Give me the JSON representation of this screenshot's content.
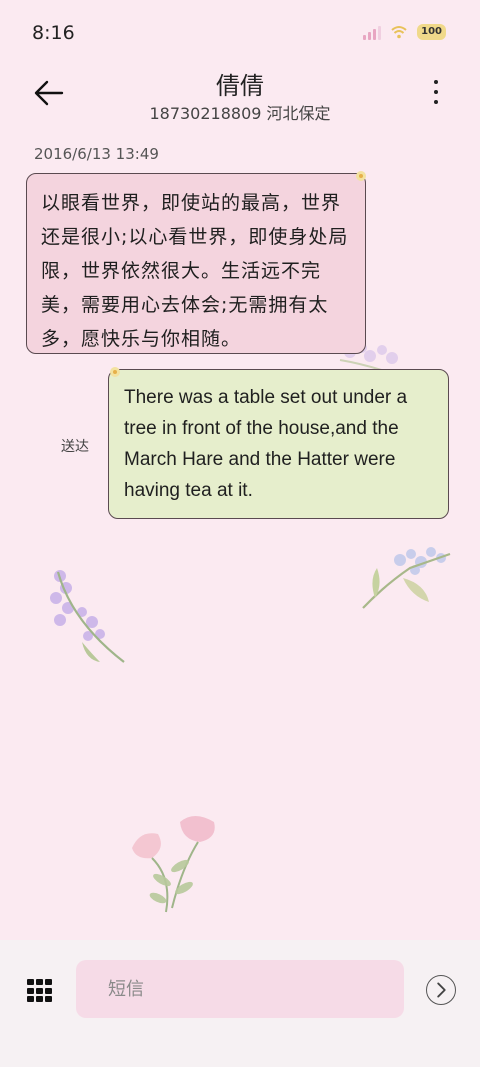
{
  "status_bar": {
    "time": "8:16",
    "battery": "100"
  },
  "header": {
    "contact_name": "倩倩",
    "contact_sub": "18730218809 河北保定"
  },
  "conversation": {
    "timestamp": "2016/6/13 13:49",
    "messages": [
      {
        "direction": "incoming",
        "text": "以眼看世界，即使站的最高，世界还是很小;以心看世界，即使身处局限，世界依然很大。生活远不完美，需要用心去体会;无需拥有太多，愿快乐与你相随。"
      },
      {
        "direction": "outgoing",
        "text": "There was a table set out under a tree in front of the house,and the March Hare and the Hatter were having tea at it.",
        "status": "送达"
      }
    ]
  },
  "composer": {
    "placeholder": "短信"
  },
  "icons": {
    "back": "arrow-left-icon",
    "more": "more-vertical-icon",
    "apps": "grid-icon",
    "send": "chevron-right-circle-icon"
  },
  "colors": {
    "background": "#fbeaf1",
    "incoming_bubble": "#f4d4de",
    "outgoing_bubble": "#e6eecc",
    "input_background": "#f6dbe7"
  }
}
